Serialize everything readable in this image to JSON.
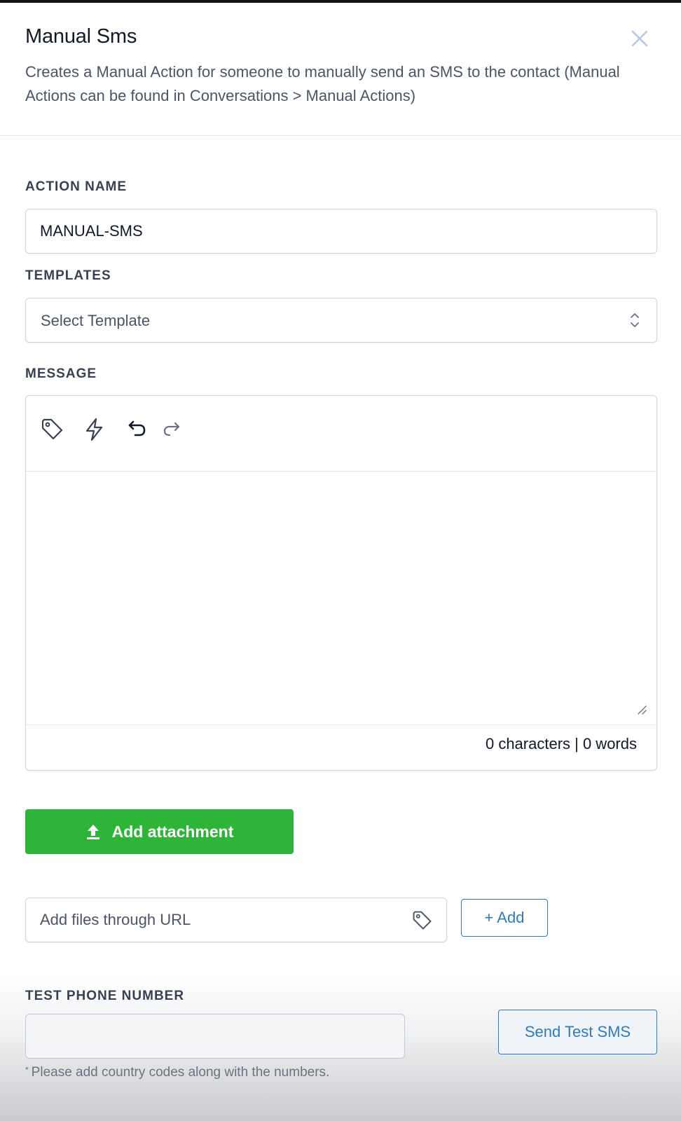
{
  "header": {
    "title": "Manual Sms",
    "subtitle": "Creates a Manual Action for someone to manually send an SMS to the contact (Manual Actions can be found in Conversations > Manual Actions)"
  },
  "action_name": {
    "label": "ACTION NAME",
    "value": "MANUAL-SMS"
  },
  "templates": {
    "label": "TEMPLATES",
    "selected": "Select Template"
  },
  "message": {
    "label": "MESSAGE",
    "toolbar_icons": [
      "tag-icon",
      "bolt-icon",
      "undo-icon",
      "redo-icon"
    ],
    "counter": "0 characters | 0 words"
  },
  "attachment": {
    "button_label": "Add attachment",
    "url_placeholder": "Add files through URL",
    "add_label": "+ Add"
  },
  "test_phone": {
    "label": "TEST PHONE NUMBER",
    "value": "",
    "send_label": "Send Test SMS",
    "hint_marker": "*",
    "hint": "Please add country codes along with the numbers."
  },
  "colors": {
    "primary_green": "#2fb43a",
    "link_blue": "#2f7bbd",
    "close_icon": "#b7c7e6"
  }
}
